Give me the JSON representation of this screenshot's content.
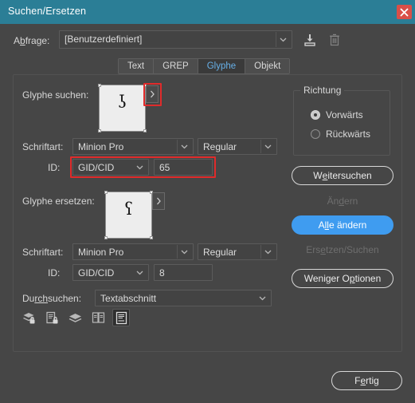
{
  "window": {
    "title": "Suchen/Ersetzen",
    "close_icon": "close-icon",
    "titlebar_color": "#2b7e96",
    "close_color": "#d94f48"
  },
  "query": {
    "label": "A",
    "label_accel": "b",
    "label_rest": "frage:",
    "value": "[Benutzerdefiniert]",
    "load_icon": "save-query-icon",
    "delete_icon": "trash-icon"
  },
  "tabs": [
    {
      "label": "Text",
      "active": false
    },
    {
      "label": "GREP",
      "active": false
    },
    {
      "label": "Glyphe",
      "active": true
    },
    {
      "label": "Objekt",
      "active": false
    }
  ],
  "find_glyph": {
    "label": "Glyphe suchen:",
    "glyph": "ʖ",
    "chevron_icon": "chevron-right-icon",
    "highlighted": true,
    "font": {
      "label": "Schriftart:",
      "family": "Minion Pro",
      "style": "Regular"
    },
    "id": {
      "label": "ID:",
      "type": "GID/CID",
      "value": "65",
      "highlighted": true
    }
  },
  "replace_glyph": {
    "label": "Glyphe ersetzen:",
    "glyph": "ʕ",
    "chevron_icon": "chevron-right-icon",
    "font": {
      "label": "Schriftart:",
      "family": "Minion Pro",
      "style": "Regular"
    },
    "id": {
      "label": "ID:",
      "type": "GID/CID",
      "value": "8"
    }
  },
  "search_scope": {
    "label_pre": "Du",
    "label_accel": "rch",
    "label_post": "suchen:",
    "value": "Textabschnitt",
    "icons": [
      {
        "name": "include-locked-layers-icon",
        "active": false
      },
      {
        "name": "include-locked-stories-icon",
        "active": false
      },
      {
        "name": "include-hidden-layers-icon",
        "active": false
      },
      {
        "name": "include-master-pages-icon",
        "active": false
      },
      {
        "name": "include-footnotes-icon",
        "active": true
      }
    ]
  },
  "direction": {
    "title": "Richtung",
    "options": [
      {
        "label": "Vorwärts",
        "checked": true
      },
      {
        "label": "Rückwärts",
        "checked": false
      }
    ]
  },
  "actions": {
    "find_next": {
      "pre": "W",
      "accel": "e",
      "post": "itersuchen",
      "state": "outline"
    },
    "change": {
      "pre": "Än",
      "accel": "d",
      "post": "ern",
      "state": "disabled"
    },
    "change_all": {
      "pre": "A",
      "accel": "ll",
      "post": "e ändern",
      "state": "primary"
    },
    "change_find": {
      "pre": "Ers",
      "accel": "e",
      "post": "tzen/Suchen",
      "state": "disabled"
    },
    "fewer_options": {
      "pre": "Weniger O",
      "accel": "p",
      "post": "tionen",
      "state": "outline"
    },
    "done": {
      "pre": "F",
      "accel": "e",
      "post": "rtig",
      "state": "outline"
    }
  },
  "colors": {
    "accent_blue": "#3f9cf0",
    "tab_active_text": "#67b0e8",
    "highlight_red": "#e02b2b",
    "panel_bg": "#464646",
    "field_bg": "#434343"
  }
}
